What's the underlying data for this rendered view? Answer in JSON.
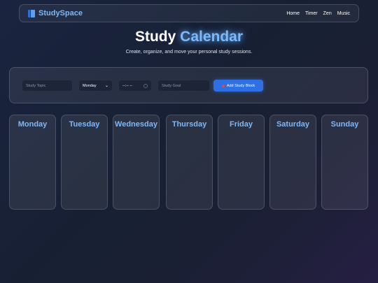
{
  "nav": {
    "brand": "StudySpace",
    "links": [
      "Home",
      "Timer",
      "Zen",
      "Music"
    ]
  },
  "hero": {
    "title_main": "Study",
    "title_accent": "Calendar",
    "subtitle": "Create, organize, and move your personal study sessions."
  },
  "form": {
    "topic_placeholder": "Study Topic",
    "day_value": "Monday",
    "time_value": "--:-- --",
    "goal_placeholder": "Study Goal",
    "add_button": "Add Study Block"
  },
  "days": [
    "Monday",
    "Tuesday",
    "Wednesday",
    "Thursday",
    "Friday",
    "Saturday",
    "Sunday"
  ],
  "colors": {
    "accent": "#7eb8f7",
    "button": "#2f6fe4"
  }
}
